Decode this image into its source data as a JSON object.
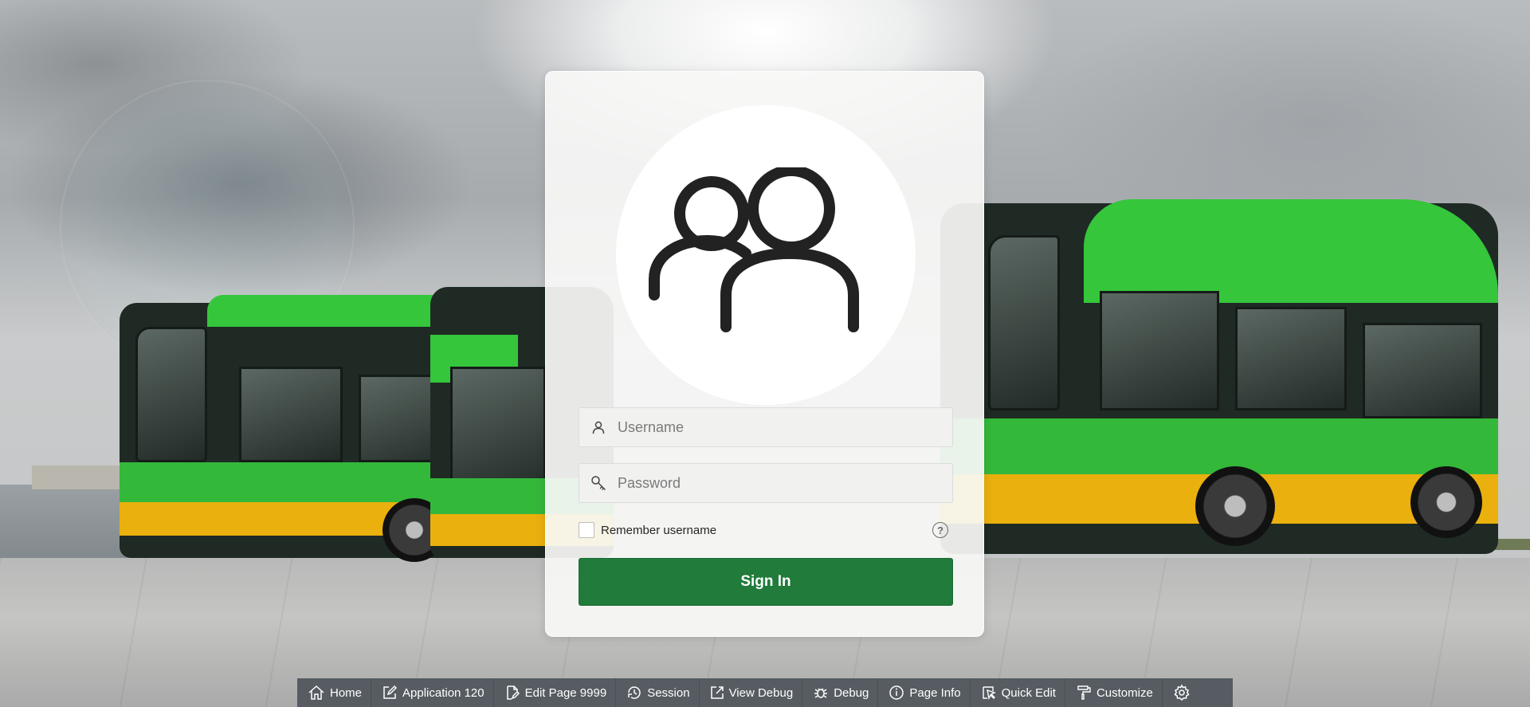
{
  "login": {
    "username_placeholder": "Username",
    "password_placeholder": "Password",
    "remember_label": "Remember username",
    "help_glyph": "?",
    "signin_label": "Sign In"
  },
  "dev_toolbar": {
    "items": [
      {
        "label": "Home",
        "icon": "home-icon"
      },
      {
        "label": "Application 120",
        "icon": "edit-icon"
      },
      {
        "label": "Edit Page 9999",
        "icon": "edit-page-icon"
      },
      {
        "label": "Session",
        "icon": "session-icon"
      },
      {
        "label": "View Debug",
        "icon": "view-debug-icon"
      },
      {
        "label": "Debug",
        "icon": "bug-icon"
      },
      {
        "label": "Page Info",
        "icon": "info-icon"
      },
      {
        "label": "Quick Edit",
        "icon": "quick-edit-icon"
      },
      {
        "label": "Customize",
        "icon": "paint-roller-icon"
      },
      {
        "label": "",
        "icon": "gear-icon"
      }
    ]
  },
  "colors": {
    "accent": "#217b3b",
    "toolbar_bg": "#565c61",
    "bus_green": "#34b83a",
    "bus_yellow": "#eab00d"
  }
}
